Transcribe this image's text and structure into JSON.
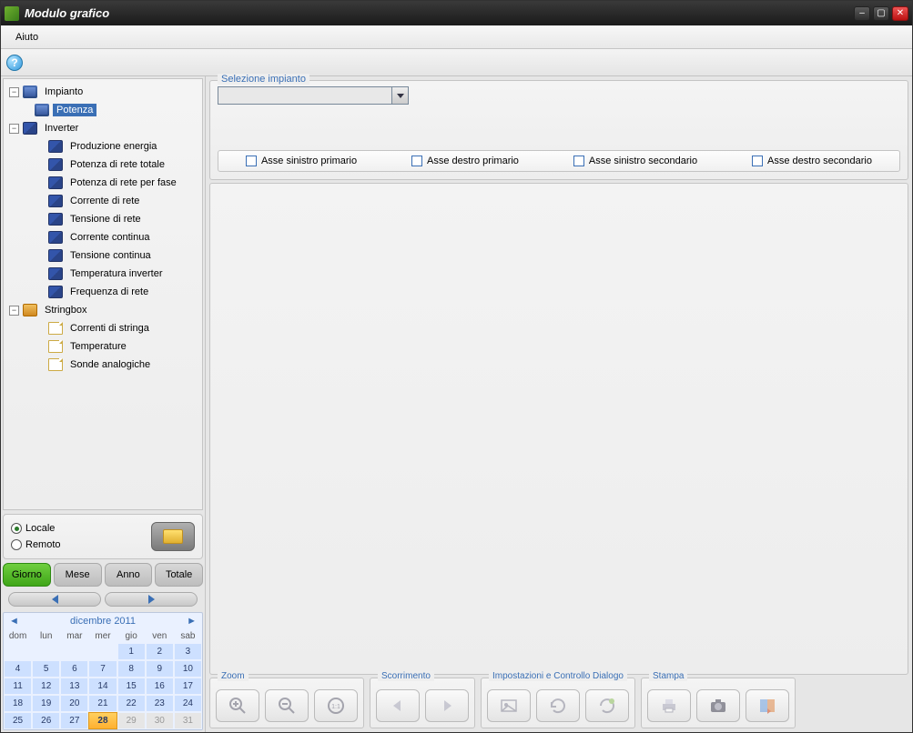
{
  "window": {
    "title": "Modulo grafico"
  },
  "menu": {
    "help": "Aiuto"
  },
  "tree": {
    "impianto": {
      "label": "Impianto",
      "potenza": "Potenza"
    },
    "inverter": {
      "label": "Inverter",
      "items": [
        "Produzione energia",
        "Potenza di rete totale",
        "Potenza di rete per fase",
        "Corrente di rete",
        "Tensione di rete",
        "Corrente continua",
        "Tensione continua",
        "Temperatura inverter",
        "Frequenza di rete"
      ]
    },
    "stringbox": {
      "label": "Stringbox",
      "items": [
        "Correnti di stringa",
        "Temperature",
        "Sonde analogiche"
      ]
    }
  },
  "source": {
    "local": "Locale",
    "remote": "Remoto"
  },
  "period": {
    "day": "Giorno",
    "month": "Mese",
    "year": "Anno",
    "total": "Totale"
  },
  "calendar": {
    "title": "dicembre 2011",
    "dow": [
      "dom",
      "lun",
      "mar",
      "mer",
      "gio",
      "ven",
      "sab"
    ],
    "leading_blanks": 4,
    "days": 31,
    "today": 28,
    "trailing_other": [
      29,
      30,
      31
    ]
  },
  "right": {
    "selection_legend": "Selezione impianto",
    "axes": {
      "left_primary": "Asse sinistro primario",
      "right_primary": "Asse destro primario",
      "left_secondary": "Asse sinistro secondario",
      "right_secondary": "Asse destro secondario"
    },
    "groups": {
      "zoom": "Zoom",
      "scroll": "Scorrimento",
      "settings": "Impostazioni e Controllo Dialogo",
      "print": "Stampa"
    }
  }
}
